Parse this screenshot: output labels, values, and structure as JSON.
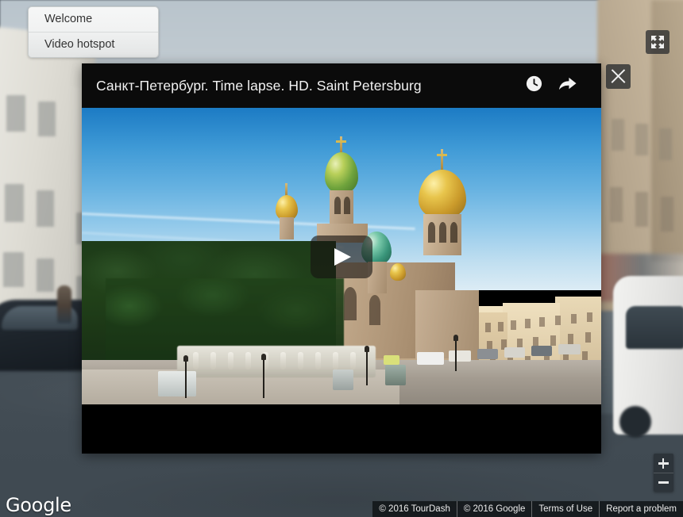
{
  "app": {
    "kind": "google-street-view-virtual-tour",
    "provider_logo": "Google"
  },
  "hotspot_menu": {
    "items": [
      {
        "label": "Welcome",
        "icon": "none"
      },
      {
        "label": "Video hotspot",
        "icon": "none"
      }
    ]
  },
  "map_controls": {
    "fullscreen": {
      "label": "",
      "icon": "fullscreen-expand-icon"
    },
    "zoom_in": {
      "label": "+",
      "icon": "plus-icon"
    },
    "zoom_out": {
      "label": "−",
      "icon": "minus-icon"
    }
  },
  "video_modal": {
    "title": "Санкт-Петербург. Time lapse. HD. Saint Petersburg",
    "header_icons": [
      {
        "name": "watch-later-clock-icon",
        "label": "Watch later"
      },
      {
        "name": "share-arrow-icon",
        "label": "Share"
      }
    ],
    "play_button": {
      "icon": "play-triangle-icon",
      "label": "Play"
    },
    "close_button": {
      "icon": "close-x-icon",
      "label": "Close"
    },
    "thumbnail_alt": "Church of the Savior on Spilled Blood, Saint Petersburg, with golden and enamelled onion domes against a blue sky, green trees at left and cream-coloured embankment buildings at right"
  },
  "attribution": {
    "items": [
      {
        "label": "© 2016 TourDash",
        "interactable": false
      },
      {
        "label": "© 2016 Google",
        "interactable": false
      },
      {
        "label": "Terms of Use",
        "interactable": true
      },
      {
        "label": "Report a problem",
        "interactable": true
      }
    ]
  },
  "colors": {
    "modal_bg": "#000000",
    "header_bg": "#0b0b0b",
    "road": "#454f57",
    "sky": "#c3ccd2",
    "menu_bg": "#f1f2f2",
    "accent_text": "#f2f2f2",
    "dome_gold": "#e8c54c",
    "dome_green": "#b9d05a",
    "thumb_sky_top": "#1c7bc4"
  }
}
